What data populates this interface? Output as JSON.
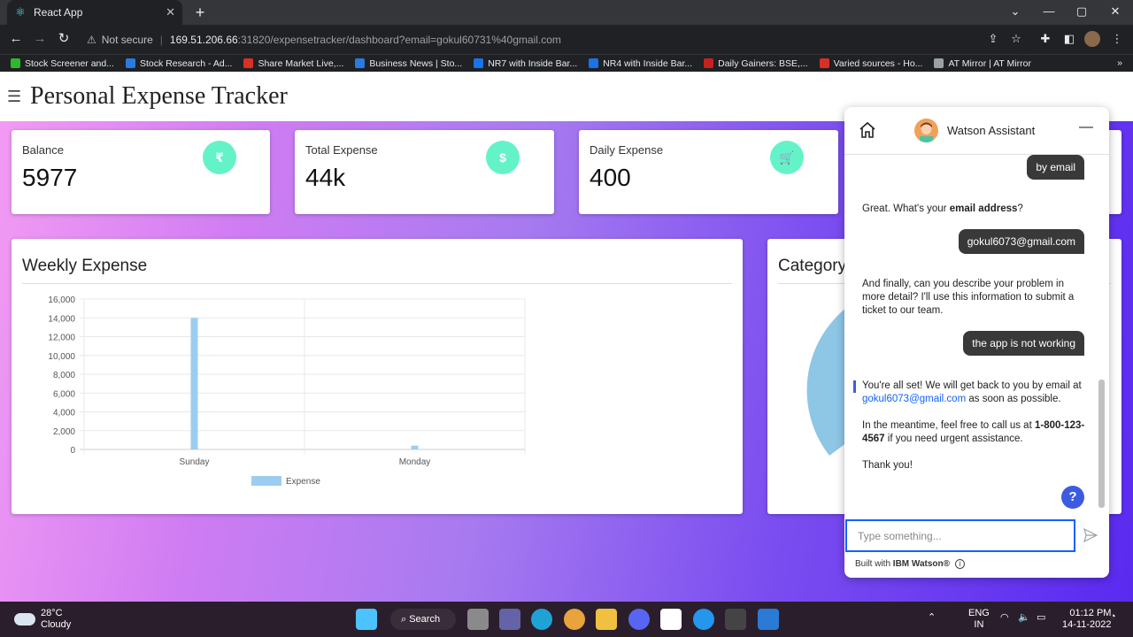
{
  "browser": {
    "tab_title": "React App",
    "url_warning": "Not secure",
    "url_host": "169.51.206.66",
    "url_path": ":31820/expensetracker/dashboard?email=gokul60731%40gmail.com",
    "bookmarks": [
      {
        "label": "Stock Screener and...",
        "icon": "bar-chart-icon",
        "color": "#2eb82e"
      },
      {
        "label": "Stock Research - Ad...",
        "icon": "m-icon",
        "color": "#2a7ae2"
      },
      {
        "label": "Share Market Live,...",
        "icon": "et-icon",
        "color": "#d93025"
      },
      {
        "label": "Business News | Sto...",
        "icon": "z-icon",
        "color": "#2a7ae2"
      },
      {
        "label": "NR7 with Inside Bar...",
        "icon": "ci-icon",
        "color": "#1a73e8"
      },
      {
        "label": "NR4 with Inside Bar...",
        "icon": "ci-icon",
        "color": "#1a73e8"
      },
      {
        "label": "Daily Gainers: BSE,...",
        "icon": "r-icon",
        "color": "#c5221f"
      },
      {
        "label": "Varied sources - Ho...",
        "icon": "et-icon",
        "color": "#d93025"
      },
      {
        "label": "AT Mirror | AT Mirror",
        "icon": "at-icon",
        "color": "#9aa0a6"
      }
    ]
  },
  "app": {
    "title": "Personal Expense Tracker",
    "stats": [
      {
        "label": "Balance",
        "value": "5977",
        "icon": "rupee-icon"
      },
      {
        "label": "Total Expense",
        "value": "44k",
        "icon": "money-icon"
      },
      {
        "label": "Daily Expense",
        "value": "400",
        "icon": "cart-icon"
      }
    ],
    "weekly_title": "Weekly Expense",
    "category_title": "Category"
  },
  "chart_data": {
    "type": "bar",
    "categories": [
      "Sunday",
      "Monday"
    ],
    "series": [
      {
        "name": "Expense",
        "values": [
          14000,
          400
        ],
        "color": "#9ccdf0"
      }
    ],
    "yticks": [
      "16,000",
      "14,000",
      "12,000",
      "10,000",
      "8,000",
      "6,000",
      "4,000",
      "2,000",
      "0"
    ],
    "ylim": [
      0,
      16000
    ],
    "grid": true,
    "legend": "bottom"
  },
  "watson": {
    "name": "Watson Assistant",
    "messages": {
      "user1": "by email",
      "bot1_pre": "Great. What's your ",
      "bot1_bold": "email address",
      "bot1_post": "?",
      "user2": "gokul6073@gmail.com",
      "bot2": "And finally, can you describe your problem in more detail? I'll use this information to submit a ticket to our team.",
      "user3": "the app is not working",
      "bot3_pre": "You're all set! We will get back to you by email at ",
      "bot3_link": "gokul6073@gmail.com",
      "bot3_post": " as soon as possible.",
      "bot4_pre": "In the meantime, feel free to call us at ",
      "bot4_bold": "1-800-123-4567",
      "bot4_post": " if you need urgent assistance.",
      "bot5": "Thank you!"
    },
    "input_placeholder": "Type something...",
    "footer_pre": "Built with ",
    "footer_bold": "IBM Watson®"
  },
  "taskbar": {
    "temp": "28°C",
    "weather": "Cloudy",
    "search": "Search",
    "lang1": "ENG",
    "lang2": "IN",
    "time": "01:12 PM",
    "date": "14-11-2022"
  }
}
